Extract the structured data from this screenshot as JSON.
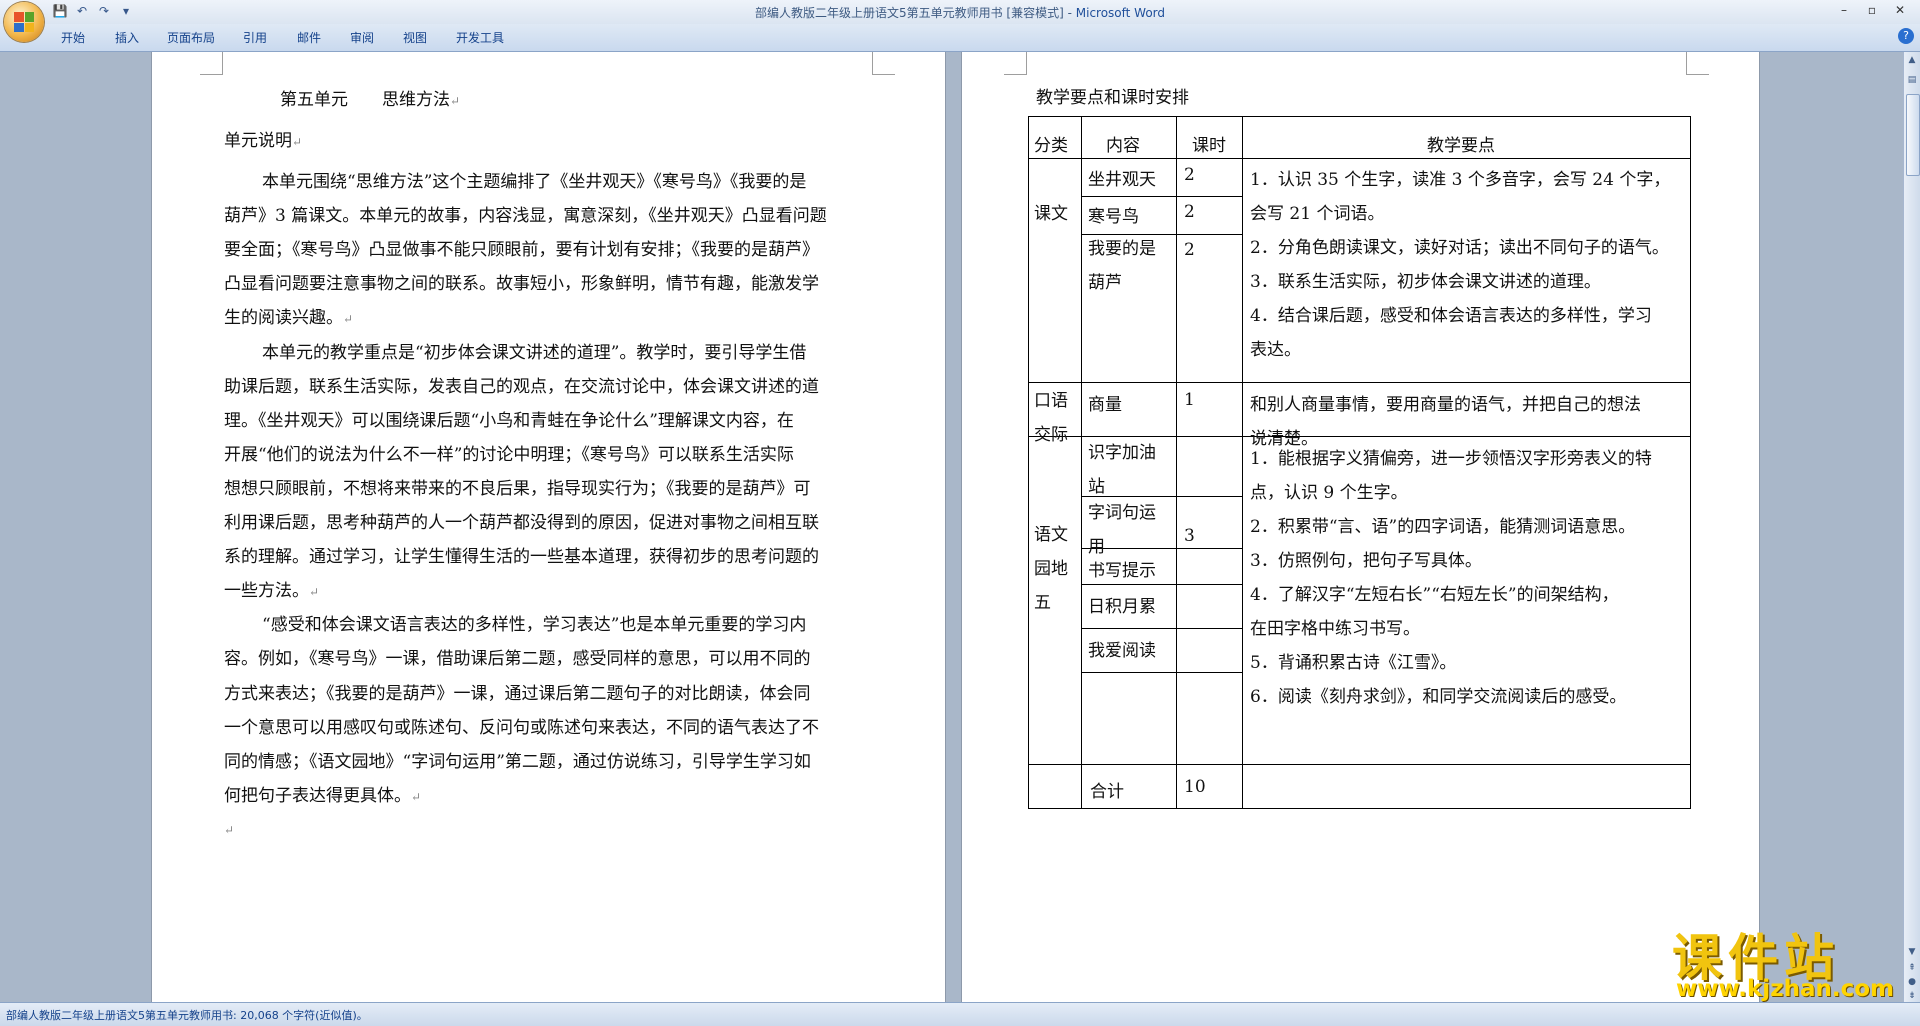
{
  "titlebar": {
    "doc_title": "部编人教版二年级上册语文5第五单元教师用书 [兼容模式]",
    "separator": " - ",
    "app_name": "Microsoft Word",
    "minimize": "–",
    "maximize": "▫",
    "close": "✕"
  },
  "qat": {
    "save": "💾",
    "undo": "↶",
    "redo": "↷",
    "more": "▾"
  },
  "ribbon": {
    "tabs": [
      "开始",
      "插入",
      "页面布局",
      "引用",
      "邮件",
      "审阅",
      "视图",
      "开发工具"
    ],
    "help": "?"
  },
  "page1": {
    "title_line": "第五单元　　思维方法",
    "section_heading": "单元说明",
    "lines": [
      "本单元围绕“思维方法”这个主题编排了《坐井观天》《寒号鸟》《我要的是",
      "葫芦》3 篇课文。本单元的故事，内容浅显，寓意深刻，《坐井观天》凸显看问题",
      "要全面；《寒号鸟》凸显做事不能只顾眼前，要有计划有安排；《我要的是葫芦》",
      "凸显看问题要注意事物之间的联系。故事短小，形象鲜明，情节有趣，能激发学",
      "生的阅读兴趣。",
      "本单元的教学重点是“初步体会课文讲述的道理”。教学时，要引导学生借",
      "助课后题，联系生活实际，发表自己的观点，在交流讨论中，体会课文讲述的道",
      "理。《坐井观天》可以围绕课后题“小鸟和青蛙在争论什么”理解课文内容，在",
      "开展“他们的说法为什么不一样”的讨论中明理；《寒号鸟》可以联系生活实际",
      "想想只顾眼前，不想将来带来的不良后果，指导现实行为；《我要的是葫芦》可",
      "利用课后题，思考种葫芦的人一个葫芦都没得到的原因，促进对事物之间相互联",
      "系的理解。通过学习，让学生懂得生活的一些基本道理，获得初步的思考问题的",
      "一些方法。",
      "“感受和体会课文语言表达的多样性，学习表达”也是本单元重要的学习内",
      "容。例如，《寒号鸟》一课，借助课后第二题，感受同样的意思，可以用不同的",
      "方式来表达；《我要的是葫芦》一课，通过课后第二题句子的对比朗读，体会同",
      "一个意思可以用感叹句或陈述句、反问句或陈述句来表达，不同的语气表达了不",
      "同的情感；《语文园地》“字词句运用”第二题，通过仿说练习，引导学生学习如",
      "何把句子表达得更具体。"
    ],
    "para_mark": "↵"
  },
  "page2": {
    "heading": "教学要点和课时安排",
    "table": {
      "headers": [
        "分类",
        "内容",
        "课时",
        "教学要点"
      ],
      "groups": [
        {
          "category": "课文",
          "items": [
            {
              "content": "坐井观天",
              "hours": "2"
            },
            {
              "content": "寒号鸟",
              "hours": "2"
            },
            {
              "content": "我要的是葫芦",
              "hours": "2"
            }
          ],
          "points": [
            "1．认识 35 个生字，读准 3 个多音字，会写 24 个字，",
            "会写 21 个词语。",
            "2．分角色朗读课文，读好对话；读出不同句子的语气。",
            "3．联系生活实际，初步体会课文讲述的道理。",
            "4．结合课后题，感受和体会语言表达的多样性，学习",
            "表达。"
          ]
        },
        {
          "category": "口语交际",
          "items": [
            {
              "content": "商量",
              "hours": "1"
            }
          ],
          "points": [
            "和别人商量事情，要用商量的语气，并把自己的想法",
            "说清楚。"
          ]
        },
        {
          "category": "语文园地五",
          "items": [
            {
              "content": "识字加油站",
              "hours": ""
            },
            {
              "content": "字词句运用",
              "hours": ""
            },
            {
              "content": "书写提示",
              "hours": ""
            },
            {
              "content": "日积月累",
              "hours": ""
            },
            {
              "content": "我爱阅读",
              "hours": ""
            }
          ],
          "hours_total": "3",
          "points": [
            "1．能根据字义猜偏旁，进一步领悟汉字形旁表义的特",
            "点，认识 9 个生字。",
            "2．积累带“言、语”的四字词语，能猜测词语意思。",
            "3．仿照例句，把句子写具体。",
            "4．了解汉字“左短右长”“右短左长”的间架结构，",
            "在田字格中练习书写。",
            "5．背诵积累古诗《江雪》。",
            "6．阅读《刻舟求剑》，和同学交流阅读后的感受。"
          ]
        }
      ],
      "total_label": "合计",
      "total_hours": "10"
    }
  },
  "statusbar": {
    "text": "部编人教版二年级上册语文5第五单元教师用书: 20,068 个字符(近似值)。"
  },
  "watermark": {
    "brand": "课件站",
    "url": "www.kjzhan.com"
  },
  "colors": {
    "ribbon": "#dbe5f1",
    "workspace": "#a9b7c9",
    "title_app": "#1f4f9a"
  }
}
